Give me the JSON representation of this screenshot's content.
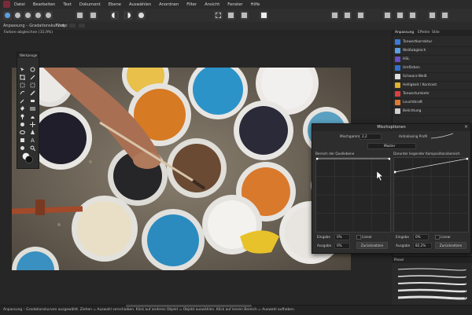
{
  "menubar": {
    "items": [
      "Datei",
      "Bearbeiten",
      "Text",
      "Dokument",
      "Ebene",
      "Auswählen",
      "Anordnen",
      "Filter",
      "Ansicht",
      "Fenster",
      "Hilfe"
    ]
  },
  "context_bar": {
    "label": "Anpassung – Gradationskurven",
    "dpi": "72 dpi"
  },
  "document_tab": {
    "label": "Farben-abgleichen (31,9%)"
  },
  "tools_panel": {
    "title": "Werkzeuge"
  },
  "right_panel": {
    "tabs": [
      "Anpassung",
      "Effekte",
      "Stile"
    ],
    "adjustments": [
      {
        "label": "Tonwertkorrektur",
        "color": "#3a7bd5"
      },
      {
        "label": "Weißabgleich",
        "color": "#5aa0e0"
      },
      {
        "label": "HSL",
        "color": "#6a4fc8"
      },
      {
        "label": "Umfärben",
        "color": "#2f6fd0"
      },
      {
        "label": "Schwarz-Weiß",
        "color": "#dedede"
      },
      {
        "label": "Helligkeit / Kontrast",
        "color": "#e0b030"
      },
      {
        "label": "Tonwertumkehr",
        "color": "#d94040"
      },
      {
        "label": "Leuchtkraft",
        "color": "#e07a30"
      },
      {
        "label": "Belichtung",
        "color": "#d0d0d0"
      }
    ]
  },
  "mischpanel": {
    "title": "Mischoptionen",
    "mode_label": "Mischgamma",
    "mode_value": "2,2",
    "profile_label": "Antialiasing Profil",
    "master_label": "Master",
    "left_graph_title": "Bereich der Quellebene",
    "right_graph_title": "Darunter liegender Kompositionsbereich",
    "left": {
      "input_label": "Eingabe",
      "input_value": "0%",
      "output_label": "Ausgabe",
      "output_value": "0%",
      "linear_label": "Linear",
      "reset_label": "Zurücksetzen"
    },
    "right": {
      "input_label": "Eingabe",
      "input_value": "0%",
      "output_label": "Ausgabe",
      "output_value": "82,2%",
      "linear_label": "Linear",
      "reset_label": "Zurücksetzen"
    }
  },
  "brushes_panel": {
    "title": "Pinsel"
  },
  "status": {
    "text": "Anpassung – Gradationskurven ausgewählt. Ziehen = Auswahl verschieben. Klick auf anderes Objekt = Objekt auswählen. Klick auf leeren Bereich = Auswahl aufheben."
  }
}
